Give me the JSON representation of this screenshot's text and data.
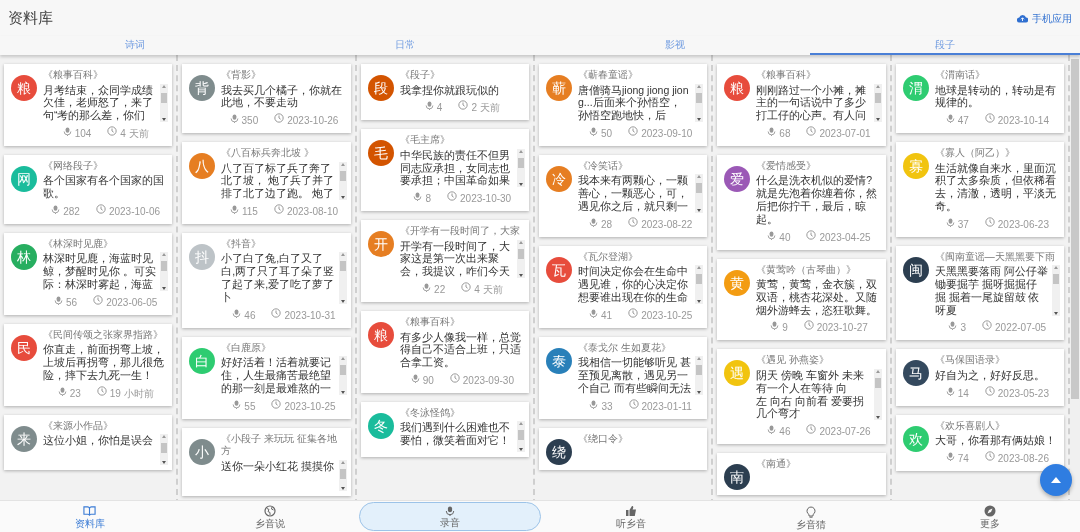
{
  "header": {
    "title": "资料库",
    "app_link": "手机应用"
  },
  "tabs": [
    {
      "label": "诗词",
      "selected": false
    },
    {
      "label": "日常",
      "selected": false
    },
    {
      "label": "影视",
      "selected": false
    },
    {
      "label": "段子",
      "selected": true
    }
  ],
  "columns": [
    {
      "cards": [
        {
          "avatar": "粮",
          "color": "#e74c3c",
          "title": "《粮事百科》",
          "text": "月考结束，众同学成绩欠佳，老师怒了，来了句“考的那么差，你们",
          "scrollable": true,
          "plays": "104",
          "time": "4 天前"
        },
        {
          "avatar": "网",
          "color": "#1abc9c",
          "title": "《网络段子》",
          "text": "各个国家有各个国家的国歌。",
          "scrollable": false,
          "plays": "282",
          "time": "2023-10-06"
        },
        {
          "avatar": "林",
          "color": "#27ae60",
          "title": "《林深时见鹿》",
          "text": "林深时见鹿，海蓝时见鲸，梦醒时见你 。可实际：林深时雾起，海蓝",
          "scrollable": true,
          "plays": "56",
          "time": "2023-06-05"
        },
        {
          "avatar": "民",
          "color": "#e74c3c",
          "title": "《民间传颂之张家界指路》",
          "text": "你直走，前面拐弯上坡，上坡后再拐弯，那儿很危险，摔下去九死一生！",
          "scrollable": false,
          "plays": "23",
          "time": "19 小时前"
        },
        {
          "avatar": "来",
          "color": "#7f8c8d",
          "title": "《来源小作品》",
          "text": "这位小姐，你怕是误会",
          "scrollable": true
        }
      ]
    },
    {
      "cards": [
        {
          "avatar": "背",
          "color": "#7f8c8d",
          "title": "《背影》",
          "text": "我去买几个橘子，你就在此地，不要走动",
          "scrollable": false,
          "plays": "350",
          "time": "2023-10-26"
        },
        {
          "avatar": "八",
          "color": "#e67e22",
          "title": "《八百标兵奔北坡 》",
          "text": "八了百了标了兵了奔了北了坡， 炮了兵了并了排了北了边了跑。 炮了",
          "scrollable": true,
          "plays": "115",
          "time": "2023-08-10"
        },
        {
          "avatar": "抖",
          "color": "#bdc3c7",
          "title": "《抖音》",
          "text": "小了白了兔,白了又了白,两了只了耳了朵了竖了起了来,爱了吃了萝了卜",
          "scrollable": true,
          "plays": "46",
          "time": "2023-10-31"
        },
        {
          "avatar": "白",
          "color": "#2ecc71",
          "title": "《白鹿原》",
          "text": "好好活着！活着就要记住，人生最痛苦最绝望的那一刻是最难熬的一",
          "scrollable": true,
          "plays": "55",
          "time": "2023-10-25"
        },
        {
          "avatar": "小",
          "color": "#7f8c8d",
          "title": "《小段子 来玩玩 征集各地方",
          "text": "送你一朵小红花 摸摸你",
          "scrollable": true
        }
      ]
    },
    {
      "cards": [
        {
          "avatar": "段",
          "color": "#d35400",
          "title": "《段子》",
          "text": "我拿捏你就跟玩似的",
          "scrollable": false,
          "plays": "4",
          "time": "2 天前"
        },
        {
          "avatar": "毛",
          "color": "#d35400",
          "title": "《毛主席》",
          "text": "中华民族的责任不但男同志应承担，女同志也要承担；中国革命如果",
          "scrollable": true,
          "plays": "8",
          "time": "2023-10-30"
        },
        {
          "avatar": "开",
          "color": "#e67e22",
          "title": "《开学有一段时间了，大家",
          "text": "开学有一段时间了，大家这是第一次出来聚会，我提议，咋们今天",
          "scrollable": true,
          "plays": "22",
          "time": "4 天前"
        },
        {
          "avatar": "粮",
          "color": "#e74c3c",
          "title": "《粮事百科》",
          "text": "有多少人像我一样，总觉得自己不适合上班，只适合拿工资。",
          "scrollable": false,
          "plays": "90",
          "time": "2023-09-30"
        },
        {
          "avatar": "冬",
          "color": "#1abc9c",
          "title": "《冬泳怪鸽》",
          "text": "我们遇到什么困难也不要怕，微笑着面对它！",
          "scrollable": true
        }
      ]
    },
    {
      "cards": [
        {
          "avatar": "蕲",
          "color": "#e67e22",
          "title": "《蕲春童谣》",
          "text": "唐僧骑马jiong jiong jiong...后面来个孙悟空，孙悟空跑地快，后",
          "scrollable": true,
          "plays": "50",
          "time": "2023-09-10"
        },
        {
          "avatar": "冷",
          "color": "#e67e22",
          "title": "《冷笑话》",
          "text": "我本来有两颗心，一颗善心，一颗恶心，可，遇见你之后，就只剩一",
          "scrollable": true,
          "plays": "28",
          "time": "2023-08-22"
        },
        {
          "avatar": "瓦",
          "color": "#e74c3c",
          "title": "《瓦尔登湖》",
          "text": "时间决定你会在生命中遇见谁，你的心决定你想要谁出现在你的生命",
          "scrollable": true,
          "plays": "41",
          "time": "2023-10-25"
        },
        {
          "avatar": "泰",
          "color": "#2980b9",
          "title": "《泰戈尔 生如夏花》",
          "text": "我相信一切能够听见 甚至预见离散，遇见另一个自己 而有些瞬间无法",
          "scrollable": true,
          "plays": "33",
          "time": "2023-01-11"
        },
        {
          "avatar": "绕",
          "color": "#2c3e50",
          "title": "《绕口令》"
        }
      ]
    },
    {
      "cards": [
        {
          "avatar": "粮",
          "color": "#e74c3c",
          "title": "《粮事百科》",
          "text": "刚刚路过一个小摊，摊主的一句话说中了多少打工仔的心声。有人问",
          "scrollable": true,
          "plays": "68",
          "time": "2023-07-01"
        },
        {
          "avatar": "爱",
          "color": "#9b59b6",
          "title": "《爱情感受》",
          "text": "什么是洗衣机似的爱情?就是先泡着你缠着你，然后把你拧干，最后，晾起。",
          "scrollable": false,
          "plays": "40",
          "time": "2023-04-25"
        },
        {
          "avatar": "黄",
          "color": "#f39c12",
          "title": "《黄莺吟（古琴曲）》",
          "text": "黄莺，黄莺，金衣簇，双双语，桃杏花深处。又随烟外游蜂去，恣狂歌舞。",
          "scrollable": false,
          "plays": "9",
          "time": "2023-10-27"
        },
        {
          "avatar": "遇",
          "color": "#f1c40f",
          "title": "《遇见 孙燕姿》",
          "text": "阴天 傍晚 车窗外 未来有一个人在等待 向左 向右 向前看 爱要拐几个弯才",
          "scrollable": true,
          "plays": "46",
          "time": "2023-07-26"
        },
        {
          "avatar": "南",
          "color": "#2c3e50",
          "title": "《南通》"
        }
      ]
    },
    {
      "cards": [
        {
          "avatar": "渭",
          "color": "#2ecc71",
          "title": "《渭南话》",
          "text": "地球是转动的，转动是有规律的。",
          "scrollable": false,
          "plays": "47",
          "time": "2023-10-14"
        },
        {
          "avatar": "寡",
          "color": "#f1c40f",
          "title": "《寡人（阿乙）》",
          "text": "生活就像自来水，里面沉积了太多杂质，但依稀看去，清澈，透明，平淡无奇。",
          "scrollable": false,
          "plays": "37",
          "time": "2023-06-23"
        },
        {
          "avatar": "闽",
          "color": "#2c3e50",
          "title": "《闽南童谣—天黑黑要下雨",
          "text": "天黑黑要落雨 阿公仔举锄要掘芋 掘呀掘掘仔掘 掘着一尾旋留鼓 依呀夏",
          "scrollable": true,
          "plays": "3",
          "time": "2022-07-05"
        },
        {
          "avatar": "马",
          "color": "#34495e",
          "title": "《马保国语录》",
          "text": "好自为之，好好反思。",
          "scrollable": false,
          "plays": "14",
          "time": "2023-05-23"
        },
        {
          "avatar": "欢",
          "color": "#2ecc71",
          "title": "《欢乐喜剧人》",
          "text": "大哥，你看那有俩姑娘！",
          "scrollable": false,
          "plays": "74",
          "time": "2023-08-26"
        }
      ]
    }
  ],
  "bottom_nav": [
    {
      "label": "资料库",
      "kind": "tab",
      "selected": true
    },
    {
      "label": "乡音说",
      "kind": "tab",
      "selected": false
    },
    {
      "label": "录音",
      "kind": "record",
      "selected": false
    },
    {
      "label": "听乡音",
      "kind": "tab",
      "selected": false
    },
    {
      "label": "乡音猜",
      "kind": "tab",
      "selected": false
    },
    {
      "label": "更多",
      "kind": "tab",
      "selected": false
    }
  ]
}
